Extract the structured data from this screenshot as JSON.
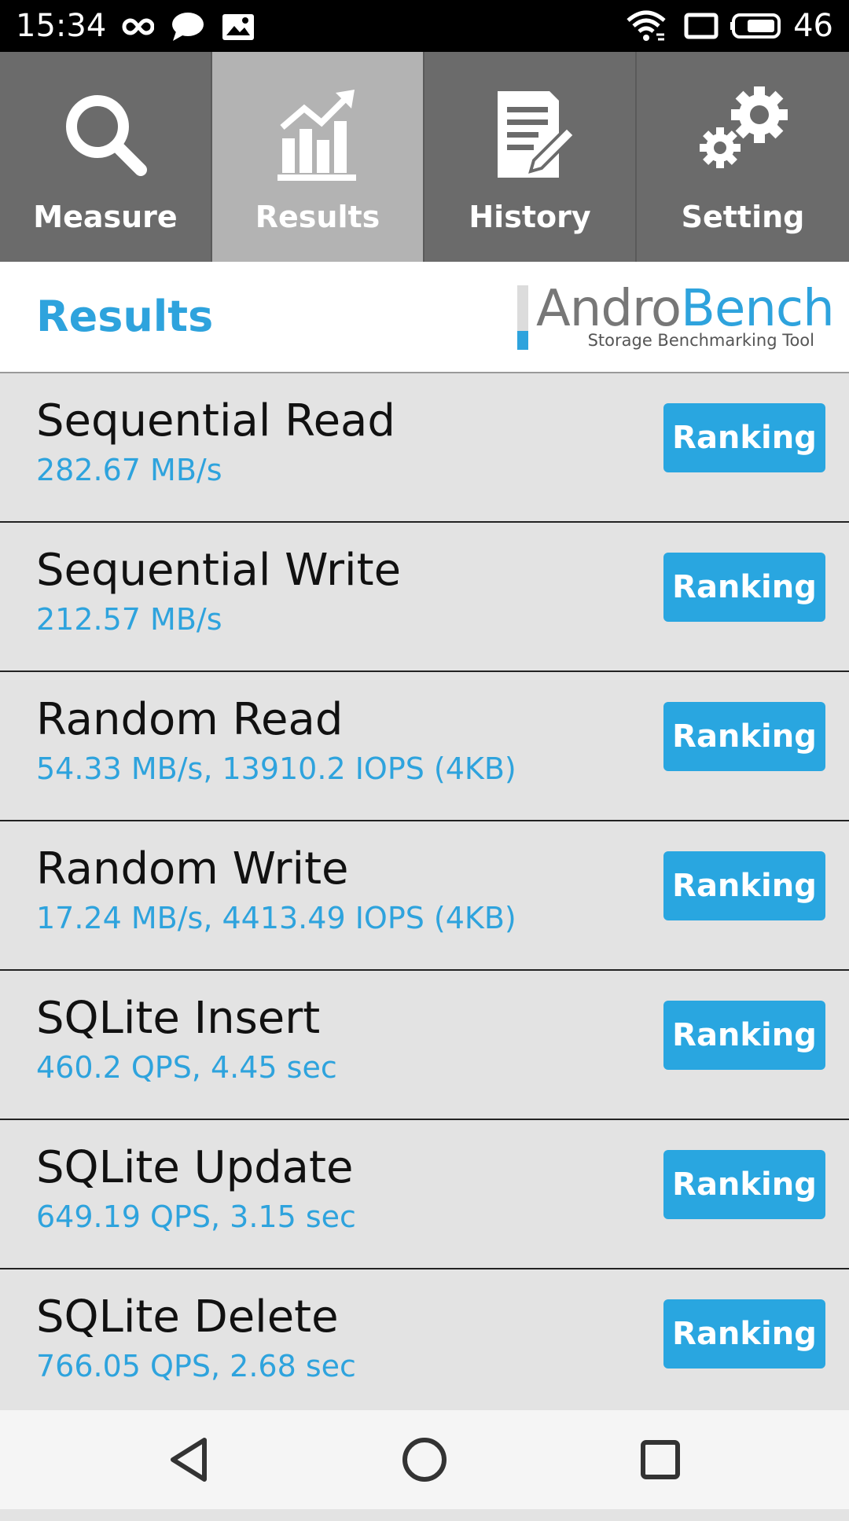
{
  "status_bar": {
    "time": "15:34",
    "battery": "46",
    "left_icons": [
      "infinity-icon",
      "chat-bubble-icon",
      "image-notification-icon"
    ],
    "right_icons": [
      "wifi-icon",
      "screen-icon",
      "battery-icon"
    ]
  },
  "tabs": [
    {
      "label": "Measure",
      "icon": "magnifier-icon",
      "active": false
    },
    {
      "label": "Results",
      "icon": "chart-icon",
      "active": true
    },
    {
      "label": "History",
      "icon": "document-edit-icon",
      "active": false
    },
    {
      "label": "Setting",
      "icon": "gears-icon",
      "active": false
    }
  ],
  "header": {
    "title": "Results",
    "logo": {
      "part1": "Andro",
      "part2": "Bench",
      "tagline": "Storage Benchmarking Tool"
    }
  },
  "results": [
    {
      "name": "Sequential Read",
      "value": "282.67 MB/s",
      "button": "Ranking"
    },
    {
      "name": "Sequential Write",
      "value": "212.57 MB/s",
      "button": "Ranking"
    },
    {
      "name": "Random Read",
      "value": "54.33 MB/s, 13910.2 IOPS (4KB)",
      "button": "Ranking"
    },
    {
      "name": "Random Write",
      "value": "17.24 MB/s, 4413.49 IOPS (4KB)",
      "button": "Ranking"
    },
    {
      "name": "SQLite Insert",
      "value": "460.2 QPS, 4.45 sec",
      "button": "Ranking"
    },
    {
      "name": "SQLite Update",
      "value": "649.19 QPS, 3.15 sec",
      "button": "Ranking"
    },
    {
      "name": "SQLite Delete",
      "value": "766.05 QPS, 2.68 sec",
      "button": "Ranking"
    }
  ],
  "nav_bar": [
    "back-icon",
    "home-icon",
    "recents-icon"
  ],
  "colors": {
    "accent": "#2ea3dd",
    "tab_bg": "#6b6b6b",
    "tab_active_bg": "#b3b3b3",
    "list_bg": "#e3e3e3"
  }
}
